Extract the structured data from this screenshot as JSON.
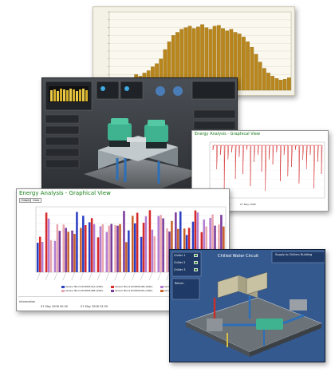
{
  "energy_main": {
    "title": "Energy Analysis - Graphical View",
    "tabs": [
      "Graph",
      "Data"
    ],
    "legend": [
      {
        "label": "Sensor Block ROOM101A (kWh)",
        "color": "#2a3fc4"
      },
      {
        "label": "Sensor Block ROOM101B (kWh)",
        "color": "#d62a2a"
      },
      {
        "label": "Sensor Block ROOM102A (kWh)",
        "color": "#b37ed1"
      },
      {
        "label": "Sensor Block ROOM102B (kWh)",
        "color": "#e8a8b0"
      },
      {
        "label": "Sensor Block ROOM103A (kWh)",
        "color": "#7a3a9a"
      },
      {
        "label": "Sensor Block ROOM103B (kWh)",
        "color": "#c8602a"
      }
    ],
    "info_label": "Information",
    "date_from": "07 May 2008 00:00",
    "date_to": "07 May 2008 23:59"
  },
  "energy_small": {
    "title": "Energy Analysis - Graphical View",
    "date_from": "07 May 2008",
    "date_to": "07 May 2008"
  },
  "circuit": {
    "title": "Chilled Water Circuit",
    "chillers": [
      "Chiller 1",
      "Chiller 2",
      "Chiller 3"
    ],
    "readings": [
      "Supply to Chillers",
      "Building",
      "Return"
    ]
  },
  "chart_data": [
    {
      "type": "bar",
      "values": [
        12,
        14,
        13,
        15,
        16,
        14,
        20,
        18,
        22,
        25,
        30,
        34,
        40,
        52,
        62,
        70,
        74,
        78,
        80,
        82,
        79,
        81,
        84,
        80,
        78,
        82,
        83,
        79,
        76,
        78,
        74,
        72,
        68,
        62,
        55,
        46,
        36,
        28,
        22,
        18,
        15,
        13,
        14,
        16
      ],
      "ylim": [
        0,
        100
      ],
      "grid": true,
      "color": "#b8861c"
    }
  ]
}
